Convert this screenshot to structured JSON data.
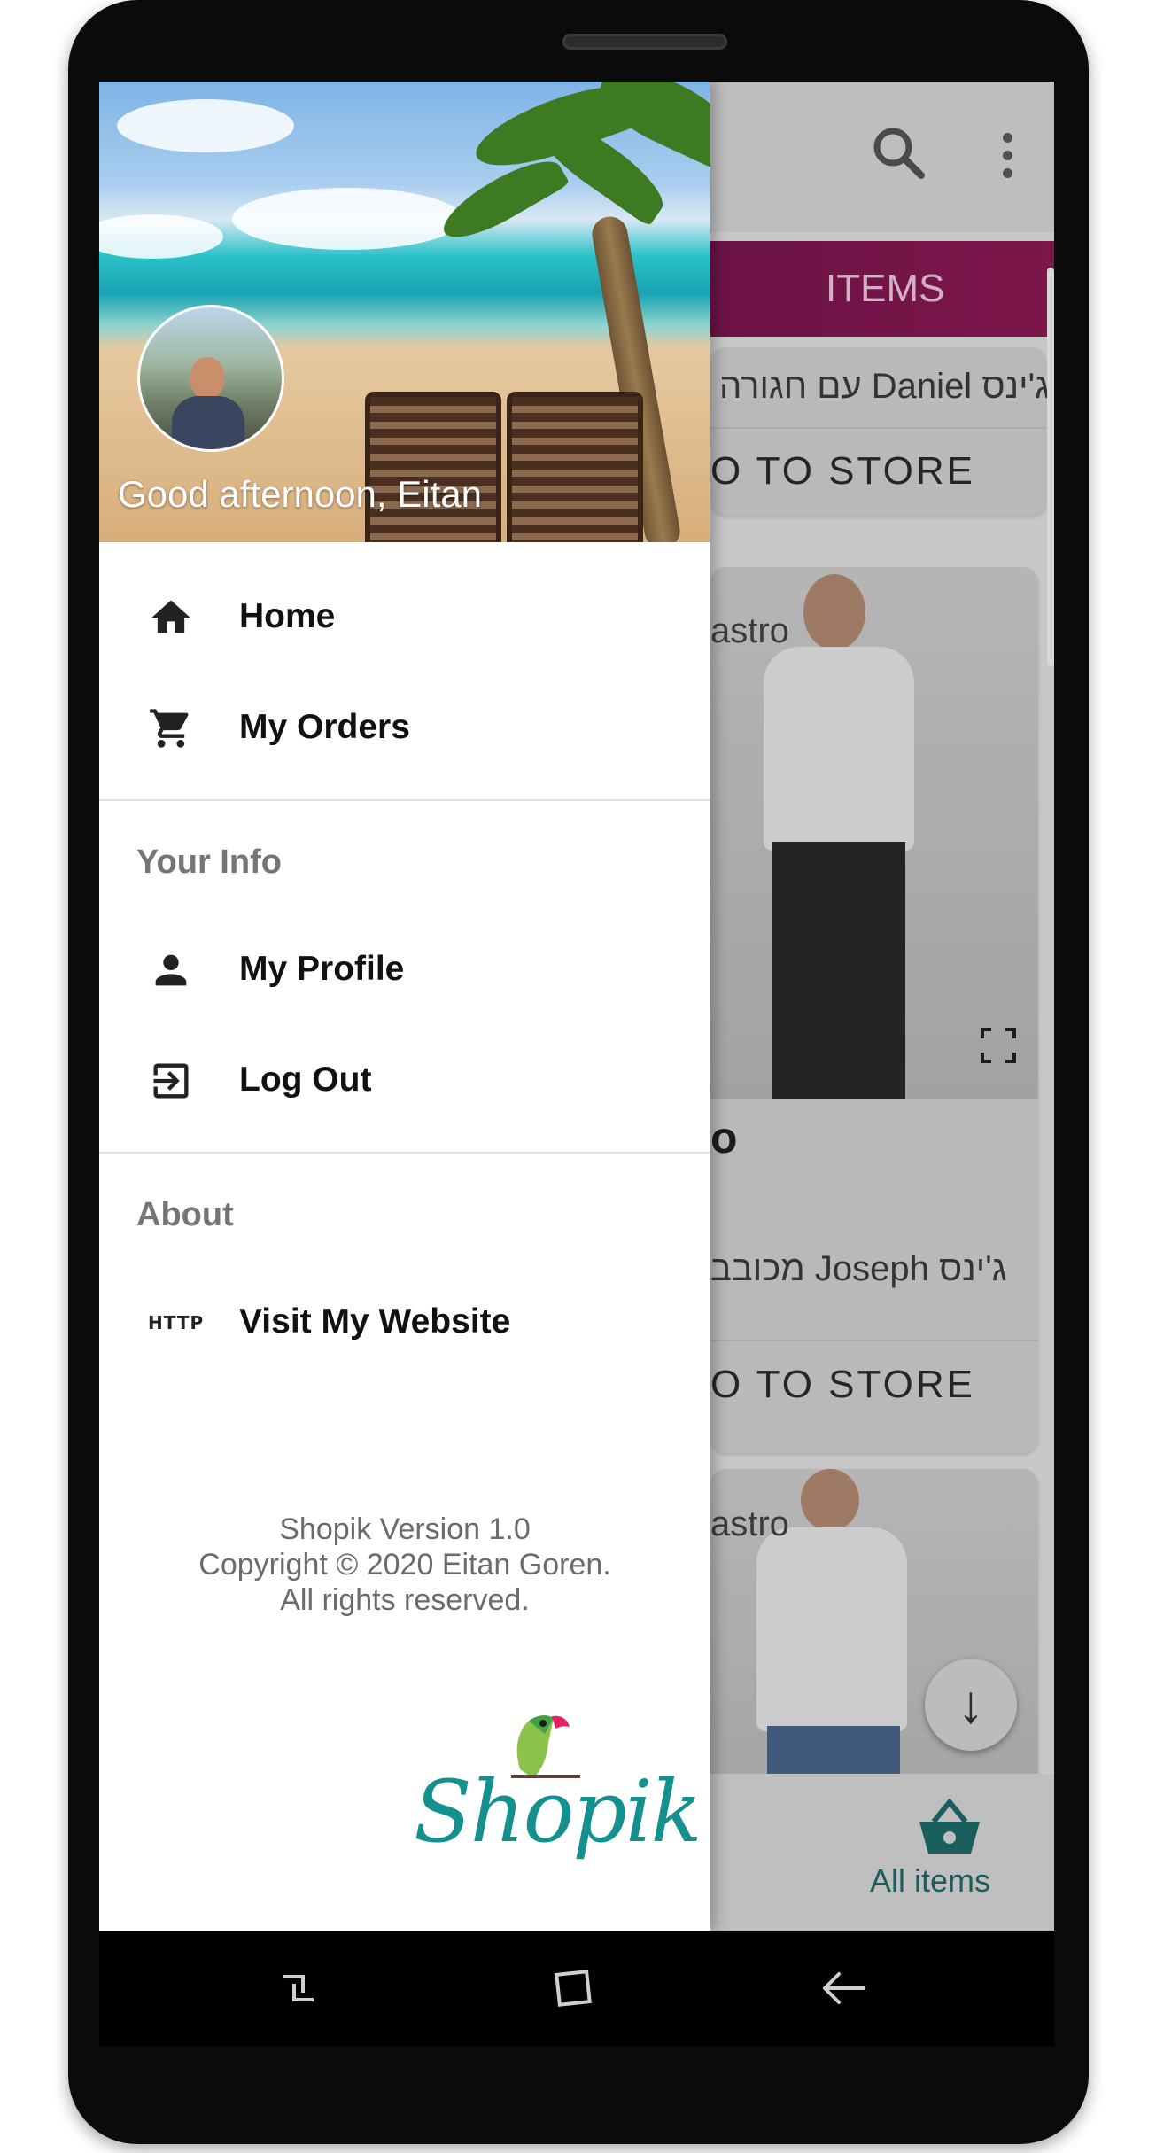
{
  "drawer": {
    "greeting": "Good afternoon, Eitan",
    "menu": {
      "home": "Home",
      "my_orders": "My Orders",
      "your_info_title": "Your Info",
      "my_profile": "My Profile",
      "log_out": "Log Out",
      "about_title": "About",
      "visit_website": "Visit My Website",
      "http_icon_text": "HTTP"
    },
    "footer": {
      "version": "Shopik Version 1.0",
      "copyright": "Copyright © 2020 Eitan Goren.",
      "rights": "All rights reserved."
    },
    "logo_text": "Shopik"
  },
  "background_app": {
    "banner_text": "ITEMS",
    "card1": {
      "title": "ג'ינס Daniel עם חגורה",
      "button": "O TO STORE"
    },
    "card2": {
      "brand": "astro",
      "name": "o",
      "description": "ג'ינס Joseph מכובב",
      "button": "O TO STORE"
    },
    "card3": {
      "brand": "astro"
    },
    "bottom_nav": {
      "all_items": "All items"
    }
  },
  "colors": {
    "accent": "#14908e",
    "banner": "#8e1a56",
    "drawer_bg": "#ffffff",
    "section_title": "#757575"
  },
  "icons": [
    "home-icon",
    "cart-icon",
    "person-icon",
    "logout-icon",
    "http-icon",
    "search-icon",
    "more-vert-icon",
    "fullscreen-icon",
    "arrow-down-icon",
    "basket-icon",
    "recents-icon",
    "home-nav-icon",
    "back-icon"
  ]
}
